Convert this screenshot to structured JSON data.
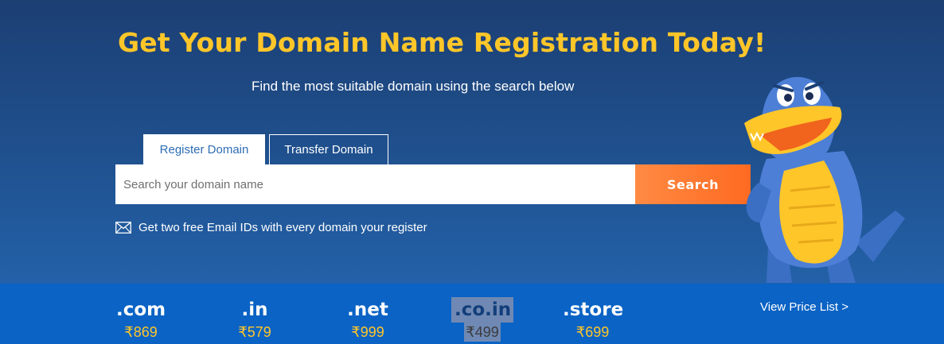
{
  "hero": {
    "title": "Get Your Domain Name Registration Today!",
    "subtitle": "Find the most suitable domain using the search below"
  },
  "tabs": [
    {
      "label": "Register Domain",
      "active": true
    },
    {
      "label": "Transfer Domain",
      "active": false
    }
  ],
  "search": {
    "placeholder": "Search your domain name",
    "value": "",
    "button_label": "Search"
  },
  "email_note": {
    "icon": "envelope-icon",
    "text": "Get two free Email IDs with every domain your register"
  },
  "tlds": [
    {
      "ext": ".com",
      "price": "₹869"
    },
    {
      "ext": ".in",
      "price": "₹579"
    },
    {
      "ext": ".net",
      "price": "₹999"
    },
    {
      "ext": ".co.in",
      "price": "₹499"
    },
    {
      "ext": ".store",
      "price": "₹699"
    }
  ],
  "view_price_list": "View Price List >",
  "colors": {
    "accent_yellow": "#ffc629",
    "search_orange": "#ff7a30",
    "strip_blue": "#0a63c5",
    "hero_blue": "#1f4f8c"
  }
}
